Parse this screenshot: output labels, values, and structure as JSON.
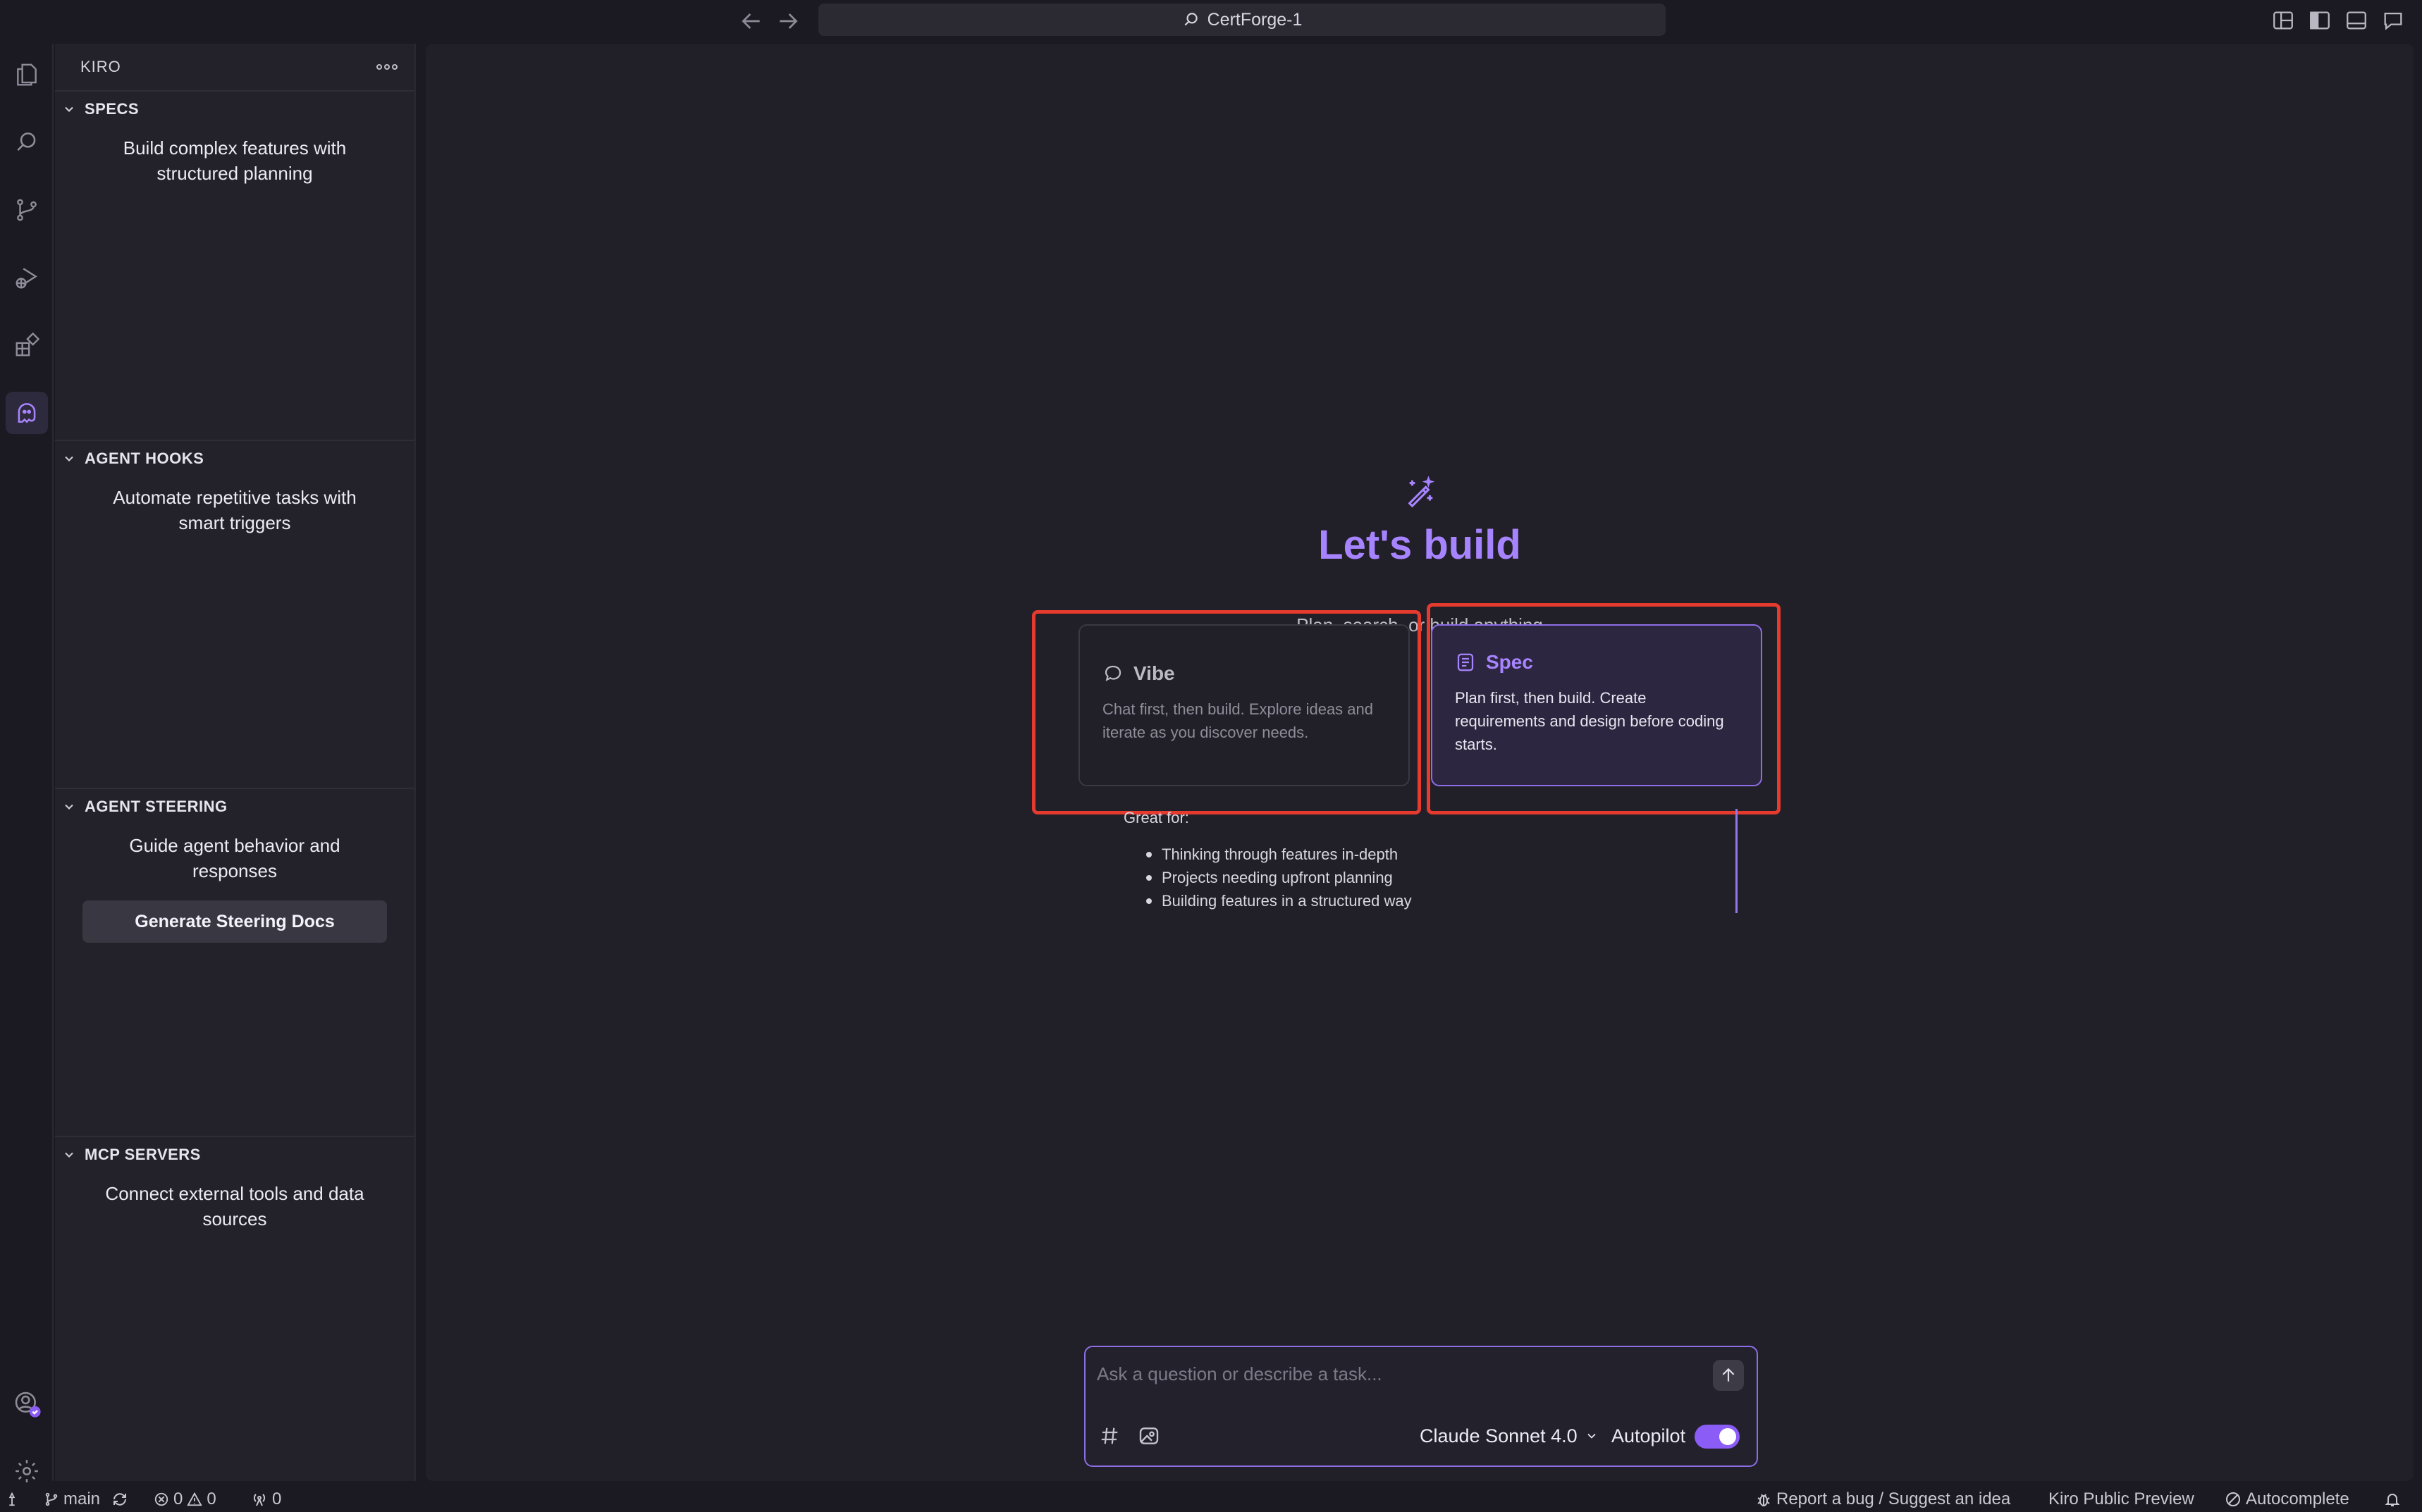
{
  "window": {
    "search_title": "CertForge-1"
  },
  "sidebar": {
    "title": "KIRO",
    "sections": [
      {
        "title": "SPECS",
        "description": "Build complex features with structured planning"
      },
      {
        "title": "AGENT HOOKS",
        "description": "Automate repetitive tasks with smart triggers"
      },
      {
        "title": "AGENT STEERING",
        "description": "Guide agent behavior and responses",
        "button": "Generate Steering Docs"
      },
      {
        "title": "MCP SERVERS",
        "description": "Connect external tools and data sources"
      }
    ]
  },
  "main": {
    "title": "Let's build",
    "subtitle": "Plan, search, or build anything",
    "cards": [
      {
        "title": "Vibe",
        "description": "Chat first, then build. Explore ideas and iterate as you discover needs."
      },
      {
        "title": "Spec",
        "description": "Plan first, then build. Create requirements and design before coding starts."
      }
    ],
    "great_for_label": "Great for:",
    "great_for": [
      "Thinking through features in-depth",
      "Projects needing upfront planning",
      "Building features in a structured way"
    ]
  },
  "chat": {
    "placeholder": "Ask a question or describe a task...",
    "model": "Claude Sonnet 4.0",
    "autopilot_label": "Autopilot",
    "autopilot_on": true
  },
  "statusbar": {
    "branch": "main",
    "errors": "0",
    "warnings": "0",
    "ports": "0",
    "report": "Report a bug / Suggest an idea",
    "preview": "Kiro Public Preview",
    "autocomplete": "Autocomplete"
  },
  "colors": {
    "accent": "#a784ff",
    "highlight": "#e53b2f",
    "background": "#1b1a22"
  }
}
